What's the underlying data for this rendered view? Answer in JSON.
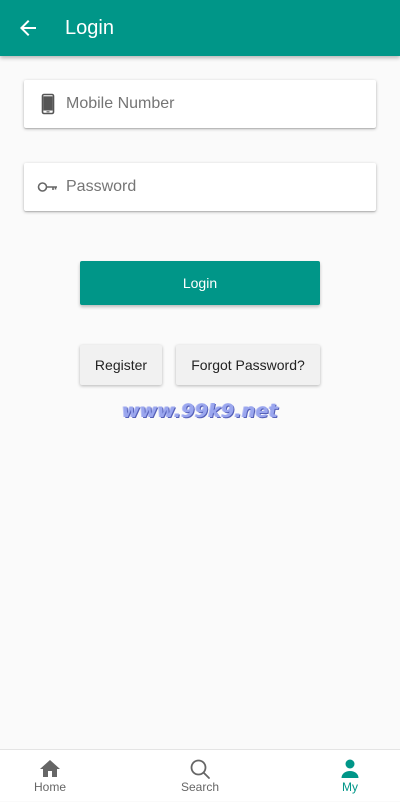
{
  "app_bar": {
    "title": "Login",
    "background_color": "#009688",
    "back_icon": "arrow-left-icon"
  },
  "form": {
    "mobile": {
      "placeholder": "Mobile Number",
      "value": "",
      "icon": "smartphone-icon"
    },
    "password": {
      "placeholder": "Password",
      "value": "",
      "icon": "key-icon"
    }
  },
  "actions": {
    "login_label": "Login",
    "register_label": "Register",
    "forgot_label": "Forgot Password?"
  },
  "watermark": {
    "text": "www.99k9.net"
  },
  "bottom_nav": {
    "active_color": "#009688",
    "inactive_color": "#666666",
    "items": [
      {
        "label": "Home",
        "icon": "home-icon",
        "active": false
      },
      {
        "label": "Search",
        "icon": "search-icon",
        "active": false
      },
      {
        "label": "My",
        "icon": "person-icon",
        "active": true
      }
    ]
  }
}
